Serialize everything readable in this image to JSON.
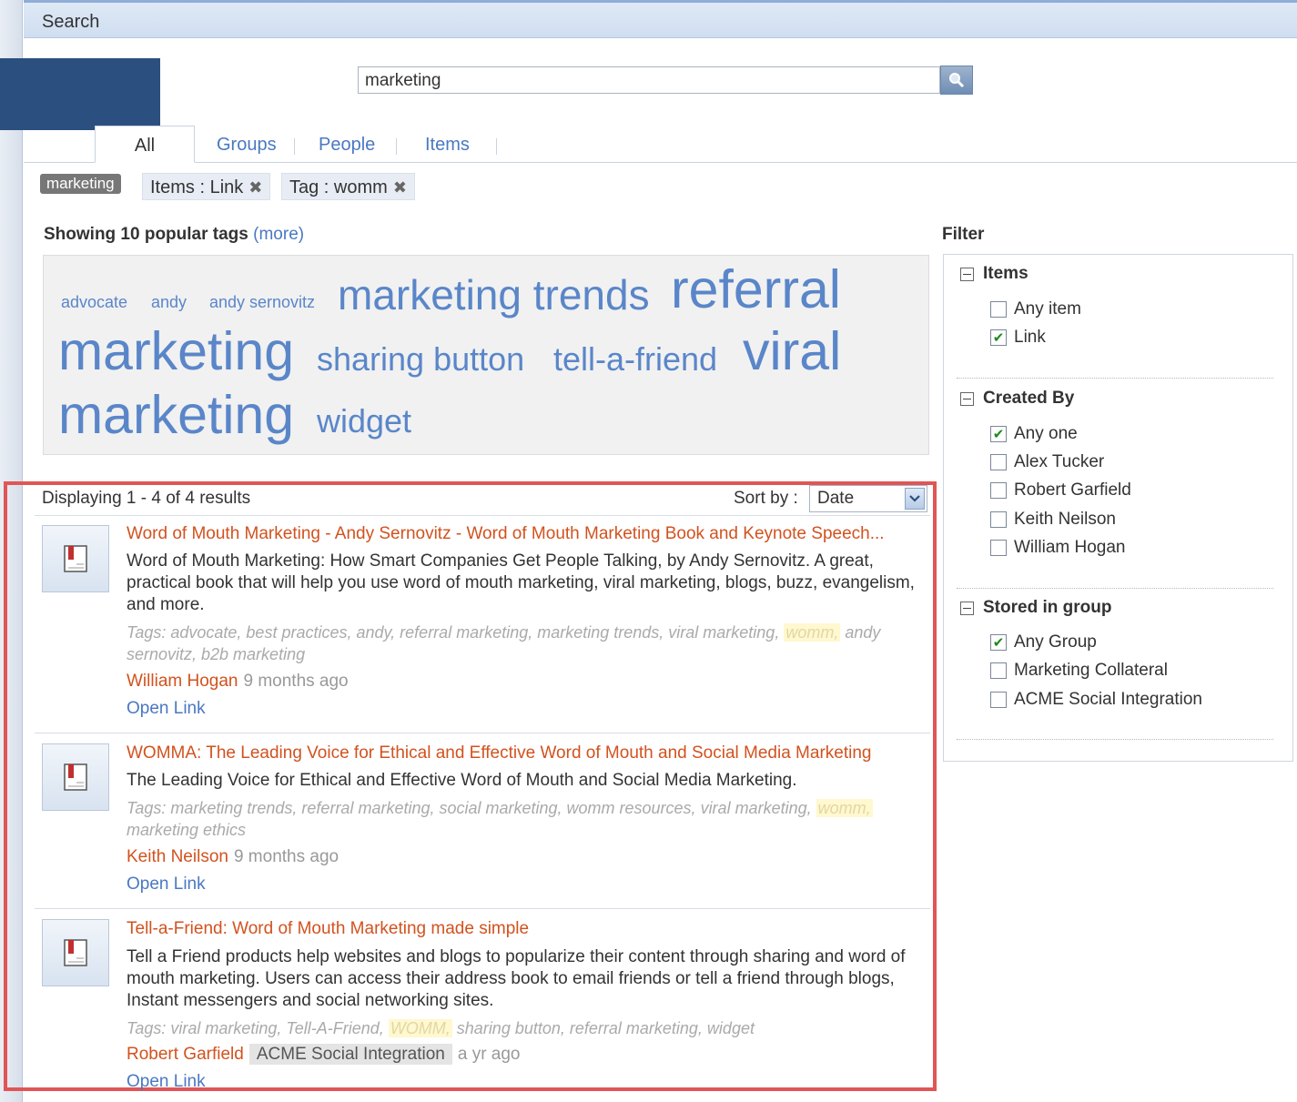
{
  "page": {
    "title": "Search"
  },
  "search": {
    "value": "marketing"
  },
  "tabs": [
    {
      "label": "All"
    },
    {
      "label": "Groups"
    },
    {
      "label": "People"
    },
    {
      "label": "Items"
    }
  ],
  "active_filters": {
    "query": "marketing",
    "chips": [
      {
        "label": "Items : Link",
        "remove": "✖"
      },
      {
        "label": "Tag : womm",
        "remove": "✖"
      }
    ]
  },
  "tag_cloud": {
    "heading": "Showing 10 popular tags",
    "more_label": "(more)",
    "tags": [
      "advocate",
      "andy",
      "andy sernovitz",
      "marketing trends",
      "referral",
      "marketing",
      "sharing button",
      "tell-a-friend",
      "viral",
      "marketing",
      "widget"
    ]
  },
  "results": {
    "summary": "Displaying 1 - 4 of 4 results",
    "sort_label": "Sort by :",
    "sort_value": "Date",
    "items": [
      {
        "title": "Word of Mouth Marketing - Andy Sernovitz - Word of Mouth Marketing Book and Keynote Speech...",
        "description": "Word of Mouth Marketing: How Smart Companies Get People Talking, by Andy Sernovitz. A great, practical book that will help you use word of mouth marketing, viral marketing, blogs, buzz, evangelism, and more.",
        "tags_before": "Tags: advocate, best practices, andy, referral marketing, marketing trends, viral marketing,",
        "tags_highlight": "womm,",
        "tags_after": "andy sernovitz, b2b marketing",
        "author": "William Hogan",
        "group": "",
        "time": "9 months ago",
        "open": "Open Link"
      },
      {
        "title": "WOMMA: The Leading Voice for Ethical and Effective Word of Mouth and Social Media Marketing",
        "description": "The Leading Voice for Ethical and Effective Word of Mouth and Social Media Marketing.",
        "tags_before": "Tags: marketing trends, referral marketing, social marketing, womm resources, viral marketing,",
        "tags_highlight": "womm,",
        "tags_after": "marketing ethics",
        "author": "Keith Neilson",
        "group": "",
        "time": "9 months ago",
        "open": "Open Link"
      },
      {
        "title": "Tell-a-Friend: Word of Mouth Marketing made simple",
        "description": "Tell a Friend products help websites and blogs to popularize their content through sharing and word of mouth marketing. Users can access their address book to email friends or tell a friend through blogs, Instant messengers and social networking sites.",
        "tags_before": "Tags: viral marketing, Tell-A-Friend,",
        "tags_highlight": "WOMM,",
        "tags_after": "sharing button, referral marketing, widget",
        "author": "Robert Garfield",
        "group": "ACME Social Integration",
        "time": "a yr ago",
        "open": "Open Link"
      }
    ]
  },
  "filter": {
    "label": "Filter",
    "sections": [
      {
        "title": "Items",
        "options": [
          {
            "label": "Any item",
            "checked": false
          },
          {
            "label": "Link",
            "checked": true
          }
        ]
      },
      {
        "title": "Created By",
        "options": [
          {
            "label": "Any one",
            "checked": true
          },
          {
            "label": "Alex Tucker",
            "checked": false
          },
          {
            "label": "Robert Garfield",
            "checked": false
          },
          {
            "label": "Keith Neilson",
            "checked": false
          },
          {
            "label": "William Hogan",
            "checked": false
          }
        ]
      },
      {
        "title": "Stored in group",
        "options": [
          {
            "label": "Any Group",
            "checked": true
          },
          {
            "label": "Marketing Collateral",
            "checked": false
          },
          {
            "label": "ACME Social Integration",
            "checked": false
          }
        ]
      }
    ]
  },
  "colors": {
    "accent": "#4a78c2",
    "result_title": "#d2521e",
    "highlight_frame": "#e05555",
    "header_block": "#2b4f7e"
  }
}
